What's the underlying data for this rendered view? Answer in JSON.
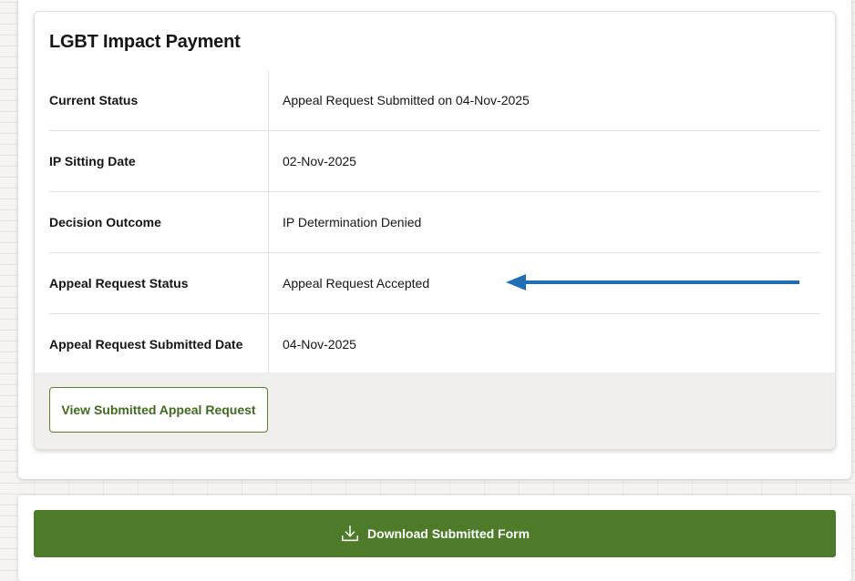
{
  "card": {
    "title": "LGBT Impact Payment",
    "rows": [
      {
        "label": "Current Status",
        "value": "Appeal Request Submitted on 04-Nov-2025"
      },
      {
        "label": "IP Sitting Date",
        "value": "02-Nov-2025"
      },
      {
        "label": "Decision Outcome",
        "value": "IP Determination Denied"
      },
      {
        "label": "Appeal Request Status",
        "value": "Appeal Request Accepted"
      },
      {
        "label": "Appeal Request Submitted Date",
        "value": "04-Nov-2025"
      }
    ],
    "view_button_label": "View Submitted Appeal Request"
  },
  "download": {
    "label": "Download Submitted Form",
    "icon": "download-icon"
  },
  "annotation": {
    "arrow_color": "#1f6fb5",
    "points_to": "Appeal Request Status"
  },
  "colors": {
    "primary_green": "#4d7b2a",
    "button_text_green": "#3f6b1f"
  }
}
